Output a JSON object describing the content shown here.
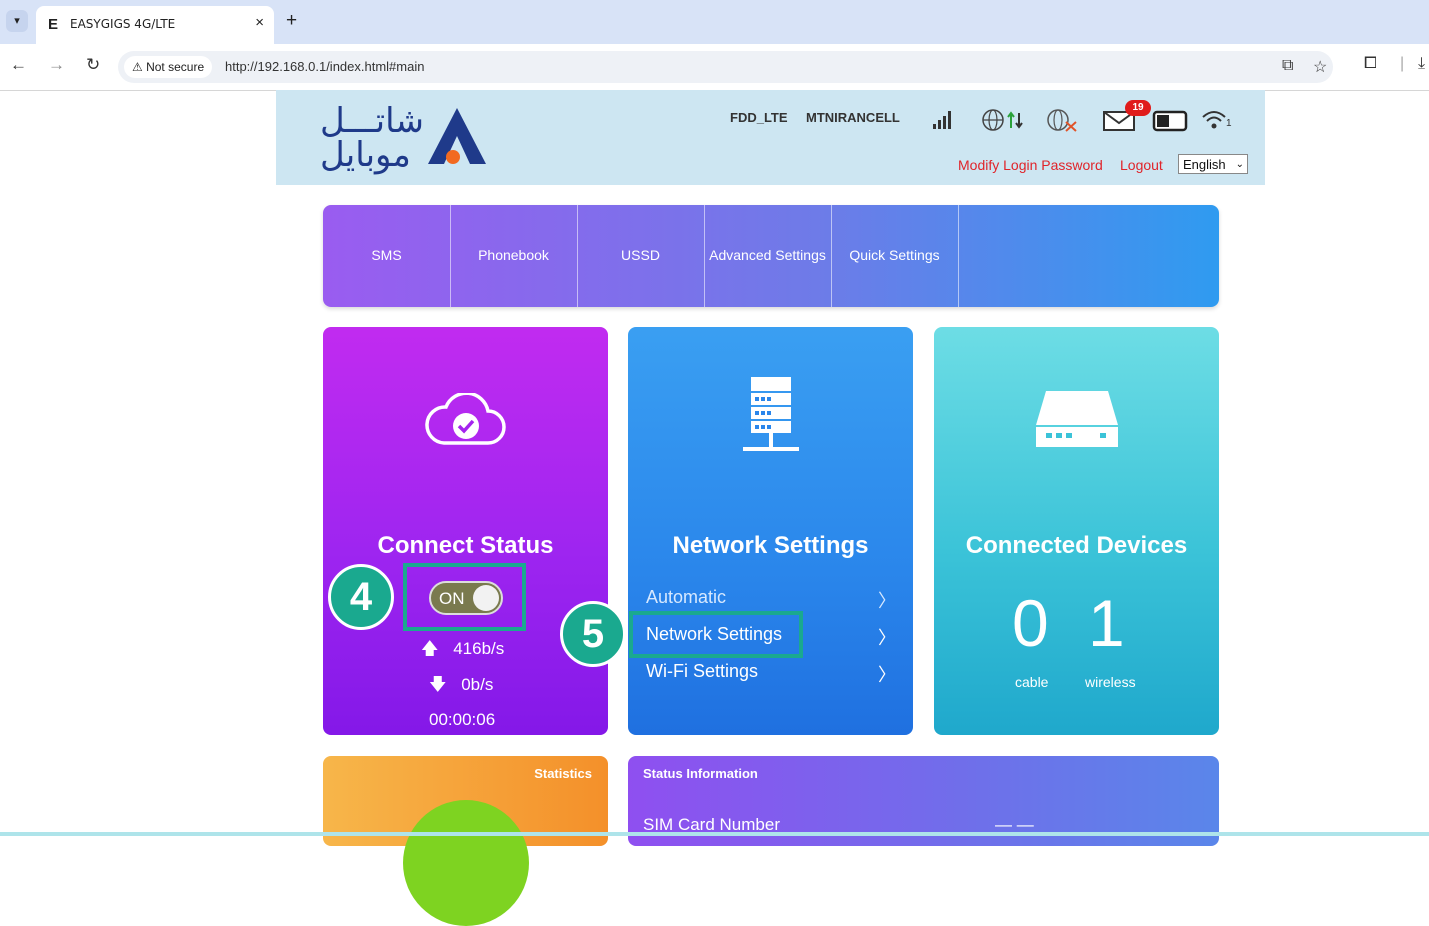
{
  "browser": {
    "tab_title": "EASYGIGS 4G/LTE",
    "tab_favicon": "E",
    "new_tab": "+",
    "tab_close": "×",
    "not_secure": "Not secure",
    "url": "http://192.168.0.1/index.html#main"
  },
  "header": {
    "logo_text_line1": "شاتـــل",
    "logo_text_line2": "موبایل",
    "network_type": "FDD_LTE",
    "operator": "MTNIRANCELL",
    "message_count": "19",
    "wifi_count": "1",
    "modify_password": "Modify Login Password",
    "logout": "Logout",
    "language": "English"
  },
  "menu": {
    "items": [
      "SMS",
      "Phonebook",
      "USSD",
      "Advanced Settings",
      "Quick Settings"
    ]
  },
  "connect": {
    "title": "Connect Status",
    "toggle": "ON",
    "upload": "416b/s",
    "download": "0b/s",
    "duration": "00:00:06",
    "step": "4"
  },
  "network": {
    "title": "Network Settings",
    "links": [
      "Automatic",
      "Network Settings",
      "Wi-Fi Settings"
    ],
    "step": "5"
  },
  "devices": {
    "title": "Connected Devices",
    "cable_count": "0",
    "wireless_count": "1",
    "cable_label": "cable",
    "wireless_label": "wireless"
  },
  "statistics": {
    "title": "Statistics"
  },
  "status_info": {
    "title": "Status Information",
    "sim_label": "SIM Card Number",
    "sim_value": "— —"
  }
}
